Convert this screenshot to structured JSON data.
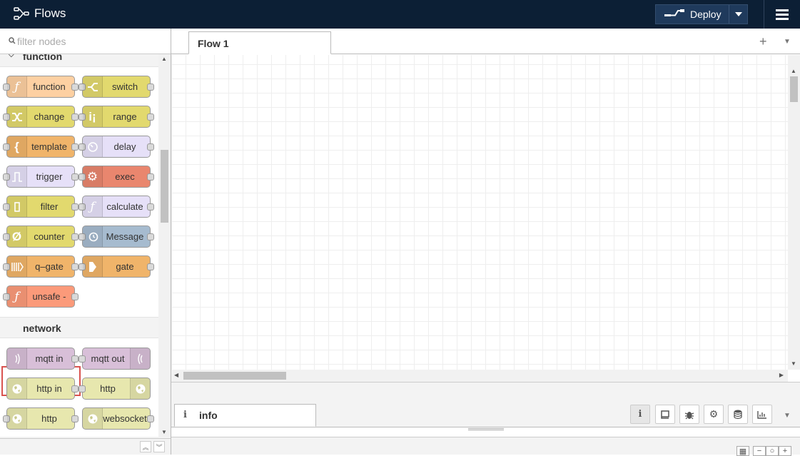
{
  "header": {
    "title": "Flows",
    "deploy_label": "Deploy"
  },
  "palette": {
    "search_placeholder": "filter nodes",
    "categories": [
      {
        "name": "function",
        "nodes": [
          {
            "label": "function",
            "color": "#fdd0a2"
          },
          {
            "label": "switch",
            "color": "#e2d96e"
          },
          {
            "label": "change",
            "color": "#e2d96e"
          },
          {
            "label": "range",
            "color": "#e2d96e"
          },
          {
            "label": "template",
            "color": "#f0b46a"
          },
          {
            "label": "delay",
            "color": "#e6e0f8"
          },
          {
            "label": "trigger",
            "color": "#e6e0f8"
          },
          {
            "label": "exec",
            "color": "#e9866e"
          },
          {
            "label": "filter",
            "color": "#e2d96e"
          },
          {
            "label": "calculate",
            "color": "#e6e0f8"
          },
          {
            "label": "counter",
            "color": "#e2d96e"
          },
          {
            "label": "Message",
            "color": "#a6bbcf"
          },
          {
            "label": "q–gate",
            "color": "#f0b46a"
          },
          {
            "label": "gate",
            "color": "#f0b46a"
          },
          {
            "label": "unsafe -",
            "color": "#fb9a7a"
          }
        ]
      },
      {
        "name": "network",
        "nodes": [
          {
            "label": "mqtt in",
            "color": "#d8bfd8"
          },
          {
            "label": "mqtt out",
            "color": "#d8bfd8"
          },
          {
            "label": "http in",
            "color": "#e7e7ae"
          },
          {
            "label": "http",
            "color": "#e7e7ae"
          },
          {
            "label": "http",
            "color": "#e7e7ae"
          },
          {
            "label": "websocket",
            "color": "#e7e7ae"
          }
        ]
      }
    ]
  },
  "workspace": {
    "tabs": [
      {
        "label": "Flow 1"
      }
    ]
  },
  "sidebar": {
    "active_tab": "info",
    "buttons": [
      "info-icon",
      "book-icon",
      "bug-icon",
      "gear-icon",
      "database-icon",
      "chart-icon"
    ]
  }
}
